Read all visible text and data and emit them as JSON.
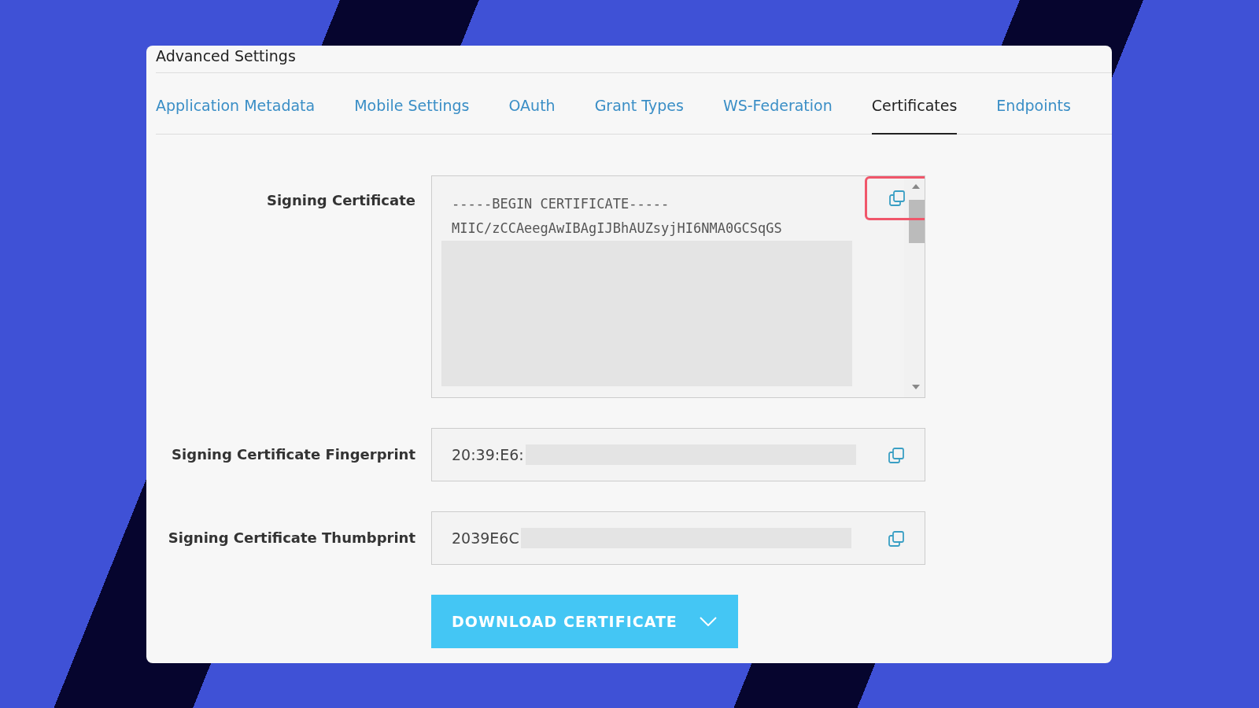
{
  "panel": {
    "title": "Advanced Settings"
  },
  "tabs": [
    {
      "label": "Application Metadata",
      "selected": false
    },
    {
      "label": "Mobile Settings",
      "selected": false
    },
    {
      "label": "OAuth",
      "selected": false
    },
    {
      "label": "Grant Types",
      "selected": false
    },
    {
      "label": "WS-Federation",
      "selected": false
    },
    {
      "label": "Certificates",
      "selected": true
    },
    {
      "label": "Endpoints",
      "selected": false
    }
  ],
  "fields": [
    {
      "kind": "multiline",
      "label": "Signing Certificate",
      "lines": [
        "-----BEGIN CERTIFICATE-----",
        "MIIC/zCCAeegAwIBAgIJBhAUZsyjHI6NMA0GCSqGS"
      ],
      "copy_highlighted": true
    },
    {
      "kind": "single",
      "label": "Signing Certificate Fingerprint",
      "lines": [
        "20:39:E6:"
      ],
      "copy_highlighted": false
    },
    {
      "kind": "single",
      "label": "Signing Certificate Thumbprint",
      "lines": [
        "2039E6C"
      ],
      "copy_highlighted": false
    }
  ],
  "download_button": {
    "label": "DOWNLOAD CERTIFICATE"
  }
}
